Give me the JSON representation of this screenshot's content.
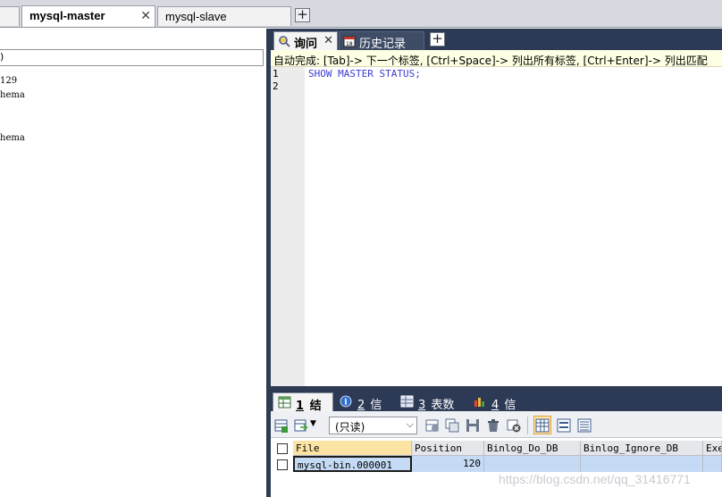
{
  "connection_tabs": [
    {
      "label": "mysql-master",
      "active": true
    },
    {
      "label": "mysql-slave",
      "active": false
    }
  ],
  "object_browser": {
    "filter_text": ")",
    "items": [
      "129",
      "hema",
      "hema"
    ]
  },
  "query_tabs": [
    {
      "label": "询问",
      "icon": "query-icon",
      "active": true
    },
    {
      "label": "历史记录",
      "icon": "history-icon",
      "active": false
    }
  ],
  "autocomplete_hint": "自动完成: [Tab]-> 下一个标签, [Ctrl+Space]-> 列出所有标签, [Ctrl+Enter]-> 列出匹配",
  "editor": {
    "lines": [
      {
        "num": "1",
        "code": "SHOW MASTER STATUS;"
      },
      {
        "num": "2",
        "code": ""
      }
    ]
  },
  "result_tabs": [
    {
      "num": "1",
      "label": "结果",
      "icon": "result-grid-icon",
      "active": true
    },
    {
      "num": "2",
      "label": "信息",
      "icon": "info-icon",
      "active": false
    },
    {
      "num": "3",
      "label": "表数据",
      "icon": "table-data-icon",
      "active": false
    },
    {
      "num": "4",
      "label": "信息",
      "icon": "messages-icon",
      "active": false
    }
  ],
  "result_toolbar": {
    "mode_select": "(只读)"
  },
  "result_grid": {
    "columns": [
      "File",
      "Position",
      "Binlog_Do_DB",
      "Binlog_Ignore_DB",
      "Exe"
    ],
    "rows": [
      [
        "mysql-bin.000001",
        "120",
        "",
        "",
        ""
      ]
    ]
  },
  "watermark": "https://blog.csdn.net/qq_31416771",
  "colors": {
    "dark_panel": "#2c3a55",
    "autocomplete_bg": "#ffffe4",
    "selected_cell": "#c5dbf5",
    "sorted_header": "#fbe3a4",
    "code_keyword": "#3d3dd1"
  }
}
